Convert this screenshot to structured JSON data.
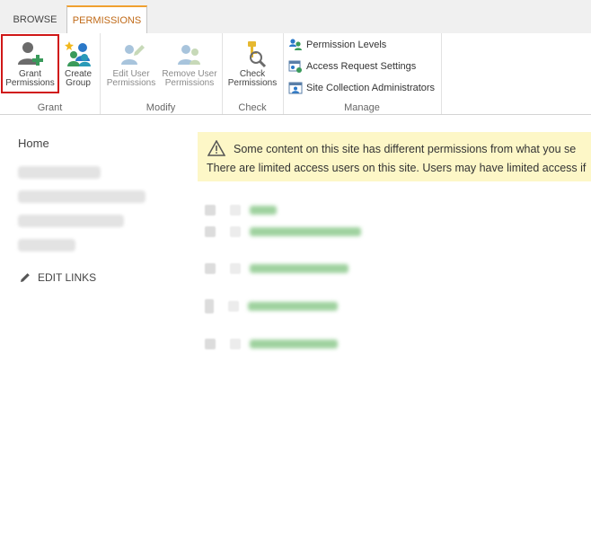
{
  "tabs": {
    "browse": "BROWSE",
    "permissions": "PERMISSIONS"
  },
  "ribbon": {
    "grant": {
      "group_label": "Grant",
      "grant_permissions": {
        "line1": "Grant",
        "line2": "Permissions"
      },
      "create_group": {
        "line1": "Create",
        "line2": "Group"
      }
    },
    "modify": {
      "group_label": "Modify",
      "edit_user_permissions": {
        "line1": "Edit User",
        "line2": "Permissions"
      },
      "remove_user_permissions": {
        "line1": "Remove User",
        "line2": "Permissions"
      }
    },
    "check": {
      "group_label": "Check",
      "check_permissions": {
        "line1": "Check",
        "line2": "Permissions"
      }
    },
    "manage": {
      "group_label": "Manage",
      "permission_levels": "Permission Levels",
      "access_request_settings": "Access Request Settings",
      "site_collection_administrators": "Site Collection Administrators"
    }
  },
  "leftnav": {
    "home": "Home",
    "edit_links": "EDIT LINKS"
  },
  "warning": {
    "line1": "Some content on this site has different permissions from what you se",
    "line2": "There are limited access users on this site. Users may have limited access if"
  },
  "colors": {
    "accent_tab": "#f0a030",
    "selected_outline": "#d01717",
    "warning_bg": "#fdf7c7"
  }
}
